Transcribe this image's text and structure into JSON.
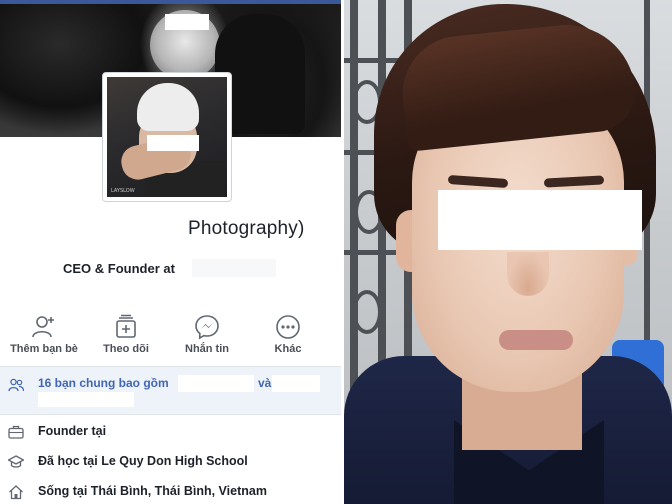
{
  "profile": {
    "name_fragment": "Photography)",
    "bio": "CEO & Founder at",
    "avatar_logo_text": "LAYSLOW"
  },
  "actions": [
    {
      "label": "Thêm bạn bè",
      "icon": "add-friend-icon"
    },
    {
      "label": "Theo dõi",
      "icon": "follow-icon"
    },
    {
      "label": "Nhắn tin",
      "icon": "messenger-icon"
    },
    {
      "label": "Khác",
      "icon": "more-icon"
    }
  ],
  "mutual": {
    "text": "16 bạn chung bao gồm",
    "conjunction": "và"
  },
  "info": [
    {
      "text": "Founder tại",
      "icon": "briefcase-icon"
    },
    {
      "text": "Đã học tại Le Quy Don High School",
      "icon": "graduation-cap-icon"
    },
    {
      "text": "Sống tại Thái Bình, Thái Bình, Vietnam",
      "icon": "home-icon"
    }
  ],
  "colors": {
    "facebook_blue": "#3b5998",
    "link_blue": "#4267b2",
    "text_dark": "#1d2129",
    "text_gray": "#4b4f56"
  }
}
